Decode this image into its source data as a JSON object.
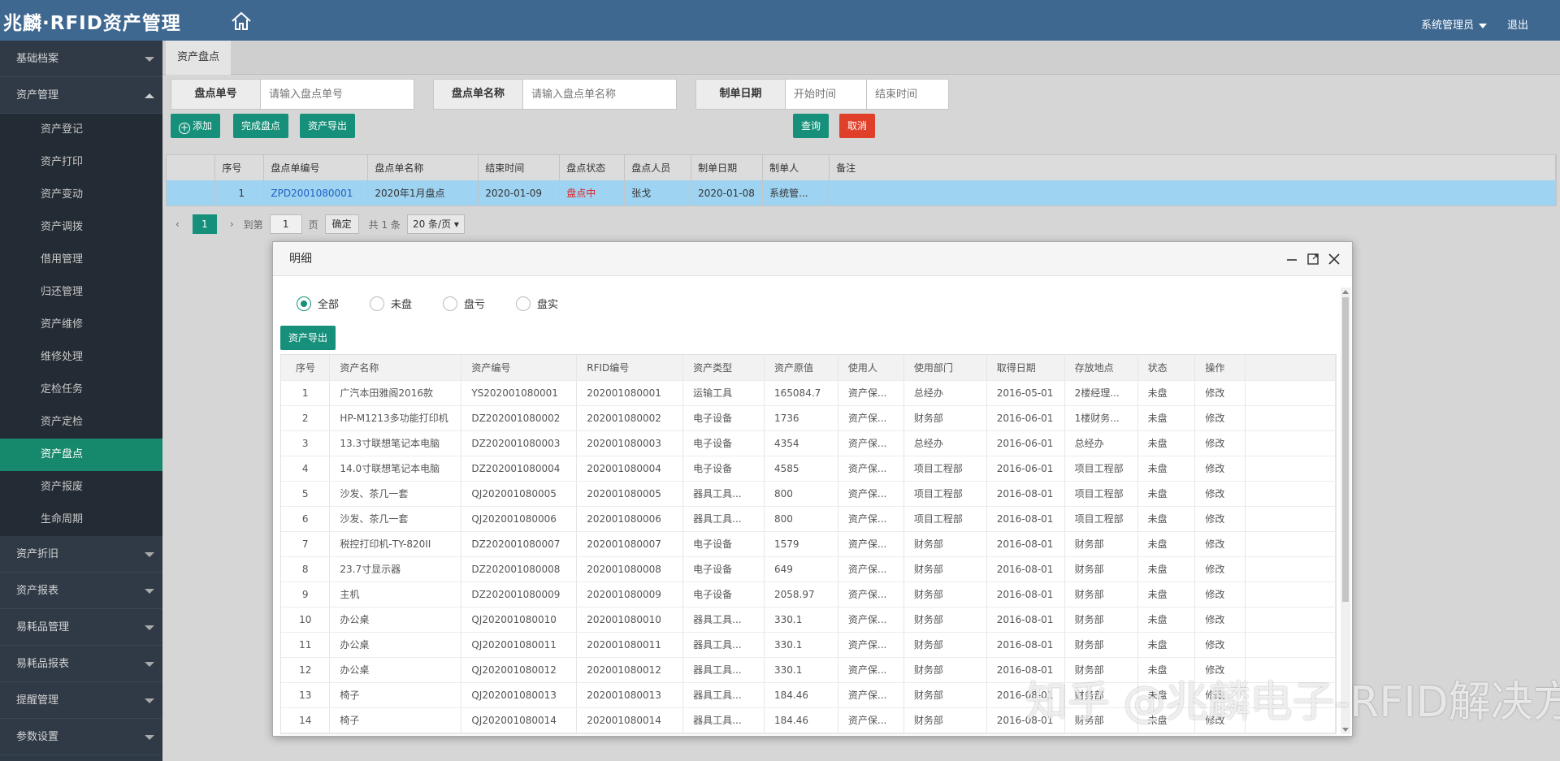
{
  "header": {
    "brand": "兆麟·RFID资产管理",
    "user": "系统管理员",
    "logout": "退出"
  },
  "sidebar": {
    "menus_top": [
      {
        "label": "基础档案"
      }
    ],
    "open_menu": {
      "label": "资产管理",
      "items": [
        "资产登记",
        "资产打印",
        "资产变动",
        "资产调拨",
        "借用管理",
        "归还管理",
        "资产维修",
        "维修处理",
        "定检任务",
        "资产定检",
        "资产盘点",
        "资产报废",
        "生命周期"
      ],
      "active": "资产盘点"
    },
    "menus_bottom": [
      {
        "label": "资产折旧"
      },
      {
        "label": "资产报表"
      },
      {
        "label": "易耗品管理"
      },
      {
        "label": "易耗品报表"
      },
      {
        "label": "提醒管理"
      },
      {
        "label": "参数设置"
      }
    ]
  },
  "tab": {
    "label": "资产盘点"
  },
  "search": {
    "no_label": "盘点单号",
    "no_placeholder": "请输入盘点单号",
    "name_label": "盘点单名称",
    "name_placeholder": "请输入盘点单名称",
    "date_label": "制单日期",
    "start_placeholder": "开始时间",
    "end_placeholder": "结束时间"
  },
  "toolbar": {
    "add": "添加",
    "complete": "完成盘点",
    "export": "资产导出",
    "query": "查询",
    "cancel": "取消"
  },
  "grid": {
    "columns": [
      "序号",
      "盘点单编号",
      "盘点单名称",
      "结束时间",
      "盘点状态",
      "盘点人员",
      "制单日期",
      "制单人",
      "备注"
    ],
    "row": [
      "1",
      "ZPD2001080001",
      "2020年1月盘点",
      "2020-01-09",
      "盘点中",
      "张戈",
      "2020-01-08",
      "系统管...",
      ""
    ]
  },
  "pager": {
    "current": "1",
    "goto": "到第",
    "page_input": "1",
    "page_unit": "页",
    "confirm": "确定",
    "total": "共 1 条",
    "size": "20 条/页"
  },
  "dialog": {
    "title": "明细",
    "filters": [
      {
        "label": "全部",
        "checked": true
      },
      {
        "label": "未盘",
        "checked": false
      },
      {
        "label": "盘亏",
        "checked": false
      },
      {
        "label": "盘实",
        "checked": false
      }
    ],
    "export": "资产导出",
    "columns": [
      "序号",
      "资产名称",
      "资产编号",
      "RFID编号",
      "资产类型",
      "资产原值",
      "使用人",
      "使用部门",
      "取得日期",
      "存放地点",
      "状态",
      "操作"
    ],
    "rows": [
      [
        "1",
        "广汽本田雅阁2016款",
        "YS202001080001",
        "202001080001",
        "运输工具",
        "165084.7",
        "资产保...",
        "总经办",
        "2016-05-01",
        "2楼经理...",
        "未盘",
        "修改"
      ],
      [
        "2",
        "HP-M1213多功能打印机",
        "DZ202001080002",
        "202001080002",
        "电子设备",
        "1736",
        "资产保...",
        "财务部",
        "2016-06-01",
        "1楼财务...",
        "未盘",
        "修改"
      ],
      [
        "3",
        "13.3寸联想笔记本电脑",
        "DZ202001080003",
        "202001080003",
        "电子设备",
        "4354",
        "资产保...",
        "总经办",
        "2016-06-01",
        "总经办",
        "未盘",
        "修改"
      ],
      [
        "4",
        "14.0寸联想笔记本电脑",
        "DZ202001080004",
        "202001080004",
        "电子设备",
        "4585",
        "资产保...",
        "项目工程部",
        "2016-06-01",
        "项目工程部",
        "未盘",
        "修改"
      ],
      [
        "5",
        "沙发、茶几一套",
        "QJ202001080005",
        "202001080005",
        "器具工具...",
        "800",
        "资产保...",
        "项目工程部",
        "2016-08-01",
        "项目工程部",
        "未盘",
        "修改"
      ],
      [
        "6",
        "沙发、茶几一套",
        "QJ202001080006",
        "202001080006",
        "器具工具...",
        "800",
        "资产保...",
        "项目工程部",
        "2016-08-01",
        "项目工程部",
        "未盘",
        "修改"
      ],
      [
        "7",
        "税控打印机-TY-820II",
        "DZ202001080007",
        "202001080007",
        "电子设备",
        "1579",
        "资产保...",
        "财务部",
        "2016-08-01",
        "财务部",
        "未盘",
        "修改"
      ],
      [
        "8",
        "23.7寸显示器",
        "DZ202001080008",
        "202001080008",
        "电子设备",
        "649",
        "资产保...",
        "财务部",
        "2016-08-01",
        "财务部",
        "未盘",
        "修改"
      ],
      [
        "9",
        "主机",
        "DZ202001080009",
        "202001080009",
        "电子设备",
        "2058.97",
        "资产保...",
        "财务部",
        "2016-08-01",
        "财务部",
        "未盘",
        "修改"
      ],
      [
        "10",
        "办公桌",
        "QJ202001080010",
        "202001080010",
        "器具工具...",
        "330.1",
        "资产保...",
        "财务部",
        "2016-08-01",
        "财务部",
        "未盘",
        "修改"
      ],
      [
        "11",
        "办公桌",
        "QJ202001080011",
        "202001080011",
        "器具工具...",
        "330.1",
        "资产保...",
        "财务部",
        "2016-08-01",
        "财务部",
        "未盘",
        "修改"
      ],
      [
        "12",
        "办公桌",
        "QJ202001080012",
        "202001080012",
        "器具工具...",
        "330.1",
        "资产保...",
        "财务部",
        "2016-08-01",
        "财务部",
        "未盘",
        "修改"
      ],
      [
        "13",
        "椅子",
        "QJ202001080013",
        "202001080013",
        "器具工具...",
        "184.46",
        "资产保...",
        "财务部",
        "2016-08-01",
        "财务部",
        "未盘",
        "修改"
      ],
      [
        "14",
        "椅子",
        "QJ202001080014",
        "202001080014",
        "器具工具...",
        "184.46",
        "资产保...",
        "财务部",
        "2016-08-01",
        "财务部",
        "未盘",
        "修改"
      ]
    ]
  },
  "watermark": "知乎 @兆麟电子-RFID解决方案",
  "colors": {
    "topbar": "#3f6891",
    "sidebar": "#2f3a46",
    "accent": "#16907a",
    "danger": "#e0402a",
    "selected_row": "#9ed3f1"
  }
}
